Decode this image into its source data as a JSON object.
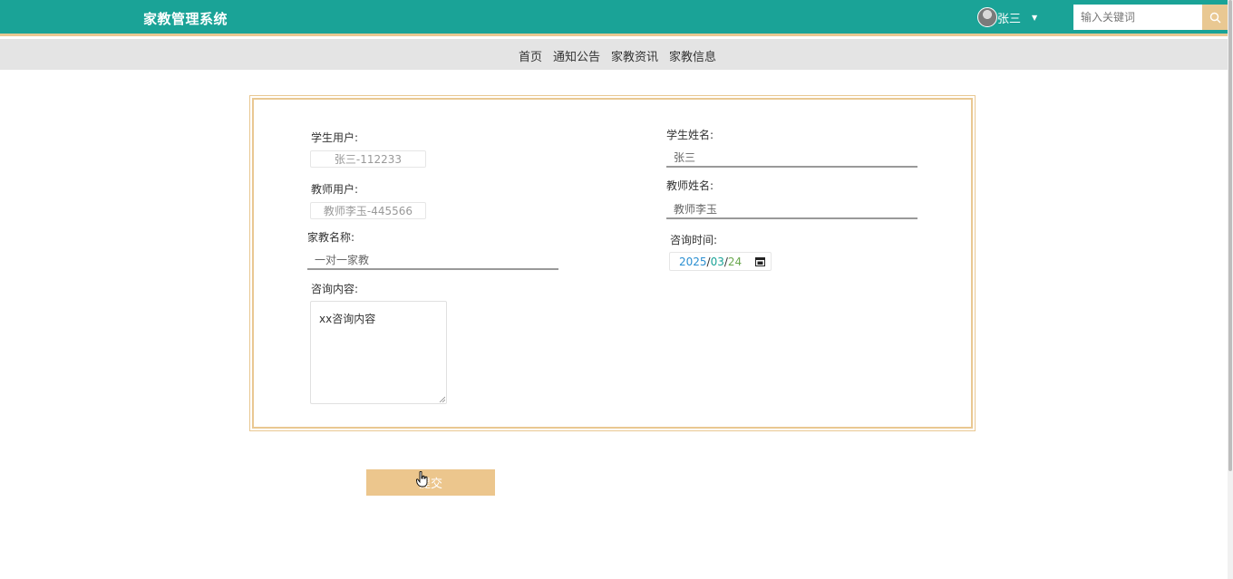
{
  "header": {
    "app_title": "家教管理系统",
    "user_name": "张三",
    "search_placeholder": "输入关键词"
  },
  "nav": {
    "items": [
      "首页",
      "通知公告",
      "家教资讯",
      "家教信息"
    ]
  },
  "form": {
    "student_user_label": "学生用户:",
    "student_user_value": "张三-112233",
    "student_name_label": "学生姓名:",
    "student_name_value": "张三",
    "teacher_user_label": "教师用户:",
    "teacher_user_value": "教师李玉-445566",
    "teacher_name_label": "教师姓名:",
    "teacher_name_value": "教师李玉",
    "tutoring_name_label": "家教名称:",
    "tutoring_name_value": "一对一家教",
    "consult_time_label": "咨询时间:",
    "consult_date": {
      "year": "2025",
      "month": "03",
      "day": "24"
    },
    "consult_content_label": "咨询内容:",
    "consult_content_value": "xx咨询内容",
    "submit_label": "提交"
  },
  "colors": {
    "header_bg": "#1aa397",
    "accent_gold": "#e9c892",
    "nav_bg": "#e4e4e4"
  },
  "icons": [
    "avatar",
    "caret-down-icon",
    "search-icon",
    "calendar-icon",
    "resize-grip-icon",
    "hand-cursor-icon"
  ]
}
